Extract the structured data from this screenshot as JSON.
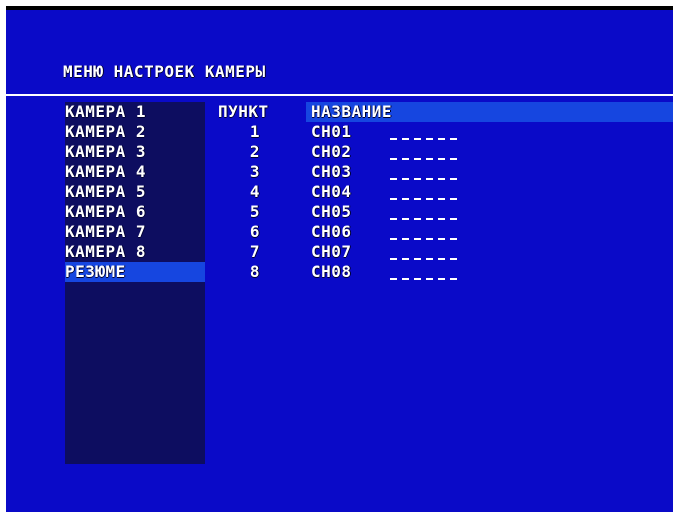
{
  "title": "МЕНЮ НАСТРОЕК КАМЕРЫ",
  "menu": [
    {
      "label": "КАМЕРА 1",
      "selected": false
    },
    {
      "label": "КАМЕРА 2",
      "selected": false
    },
    {
      "label": "КАМЕРА 3",
      "selected": false
    },
    {
      "label": "КАМЕРА 4",
      "selected": false
    },
    {
      "label": "КАМЕРА 5",
      "selected": false
    },
    {
      "label": "КАМЕРА 6",
      "selected": false
    },
    {
      "label": "КАМЕРА 7",
      "selected": false
    },
    {
      "label": "КАМЕРА 8",
      "selected": false
    },
    {
      "label": "РЕЗЮМЕ",
      "selected": true
    }
  ],
  "table": {
    "headers": {
      "item": "ПУНКТ",
      "name": "НАЗВАНИЕ"
    },
    "rows": [
      {
        "item": "1",
        "name": "CH01"
      },
      {
        "item": "2",
        "name": "CH02"
      },
      {
        "item": "3",
        "name": "CH03"
      },
      {
        "item": "4",
        "name": "CH04"
      },
      {
        "item": "5",
        "name": "CH05"
      },
      {
        "item": "6",
        "name": "CH06"
      },
      {
        "item": "7",
        "name": "CH07"
      },
      {
        "item": "8",
        "name": "CH08"
      }
    ]
  },
  "colors": {
    "background": "#0a0ac8",
    "left_panel": "#0d0d60",
    "highlight": "#1646e0",
    "text": "#ffffff"
  }
}
